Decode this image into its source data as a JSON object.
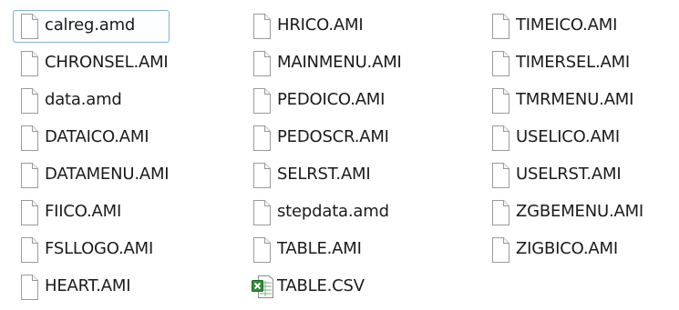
{
  "folder_view": {
    "columns": [
      {
        "files": [
          {
            "name": "calreg.amd",
            "icon": "blank-file-icon",
            "selected": true
          },
          {
            "name": "CHRONSEL.AMI",
            "icon": "blank-file-icon"
          },
          {
            "name": "data.amd",
            "icon": "blank-file-icon"
          },
          {
            "name": "DATAICO.AMI",
            "icon": "blank-file-icon"
          },
          {
            "name": "DATAMENU.AMI",
            "icon": "blank-file-icon"
          },
          {
            "name": "FIICO.AMI",
            "icon": "blank-file-icon"
          },
          {
            "name": "FSLLOGO.AMI",
            "icon": "blank-file-icon"
          },
          {
            "name": "HEART.AMI",
            "icon": "blank-file-icon"
          }
        ]
      },
      {
        "files": [
          {
            "name": "HRICO.AMI",
            "icon": "blank-file-icon"
          },
          {
            "name": "MAINMENU.AMI",
            "icon": "blank-file-icon"
          },
          {
            "name": "PEDOICO.AMI",
            "icon": "blank-file-icon"
          },
          {
            "name": "PEDOSCR.AMI",
            "icon": "blank-file-icon"
          },
          {
            "name": "SELRST.AMI",
            "icon": "blank-file-icon"
          },
          {
            "name": "stepdata.amd",
            "icon": "blank-file-icon"
          },
          {
            "name": "TABLE.AMI",
            "icon": "blank-file-icon"
          },
          {
            "name": "TABLE.CSV",
            "icon": "excel-csv-file-icon"
          }
        ]
      },
      {
        "files": [
          {
            "name": "TIMEICO.AMI",
            "icon": "blank-file-icon"
          },
          {
            "name": "TIMERSEL.AMI",
            "icon": "blank-file-icon"
          },
          {
            "name": "TMRMENU.AMI",
            "icon": "blank-file-icon"
          },
          {
            "name": "USELICO.AMI",
            "icon": "blank-file-icon"
          },
          {
            "name": "USELRST.AMI",
            "icon": "blank-file-icon"
          },
          {
            "name": "ZGBEMENU.AMI",
            "icon": "blank-file-icon"
          },
          {
            "name": "ZIGBICO.AMI",
            "icon": "blank-file-icon"
          }
        ]
      }
    ]
  },
  "colors": {
    "selection_border": "#84acdd",
    "file_icon_outline": "#9b9b9b",
    "excel_green": "#2f8b39"
  }
}
